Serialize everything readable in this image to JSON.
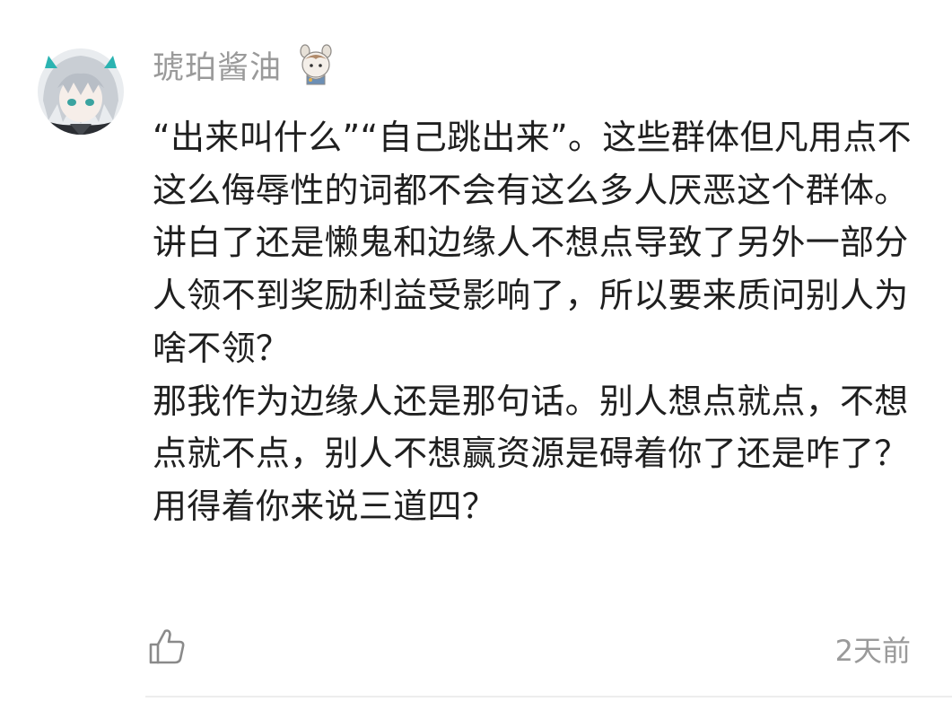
{
  "comment": {
    "username": "琥珀酱油",
    "avatar_icon": "user-avatar",
    "badge_icon": "doll-badge-icon",
    "paragraphs": [
      "“出来叫什么”“自己跳出来”。这些群体但凡用点不这么侮辱性的词都不会有这么多人厌恶这个群体。",
      "讲白了还是懒鬼和边缘人不想点导致了另外一部分人领不到奖励利益受影响了，所以要来质问别人为啥不领？",
      "那我作为边缘人还是那句话。别人想点就点，不想点就不点，别人不想赢资源是碍着你了还是咋了？用得着你来说三道四？"
    ],
    "like_icon": "thumbs-up-icon",
    "timestamp": "2天前"
  },
  "colors": {
    "text": "#1f1f1f",
    "muted": "#9a9a9a",
    "divider": "#ededed"
  }
}
